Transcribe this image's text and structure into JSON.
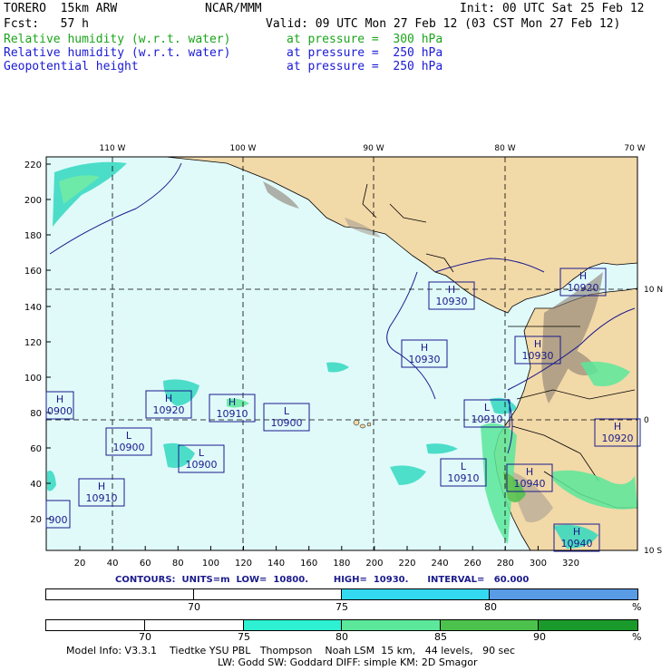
{
  "header": {
    "model": "TORERO  15km ARW",
    "center": "NCAR/MMM",
    "init": "Init: 00 UTC Sat 25 Feb 12",
    "fcst": "Fcst:   57 h",
    "valid": "Valid: 09 UTC Mon 27 Feb 12 (03 CST Mon 27 Feb 12)",
    "field1": "Relative humidity (w.r.t. water)",
    "field1_level": "at pressure =  300 hPa",
    "field2": "Relative humidity (w.r.t. water)",
    "field2_level": "at pressure =  250 hPa",
    "field3": "Geopotential height",
    "field3_level": "at pressure =  250 hPa"
  },
  "map": {
    "lon_labels": [
      "110 W",
      "100 W",
      "90 W",
      "80 W",
      "70 W"
    ],
    "lat_labels": [
      "10 N",
      "0",
      "10 S"
    ],
    "y_ticks": [
      "220",
      "200",
      "180",
      "160",
      "140",
      "120",
      "100",
      "80",
      "60",
      "40",
      "20"
    ],
    "x_ticks": [
      "20",
      "40",
      "60",
      "80",
      "100",
      "120",
      "140",
      "160",
      "180",
      "200",
      "220",
      "240",
      "260",
      "280",
      "300",
      "320"
    ],
    "pressure_systems": [
      {
        "type": "H",
        "value": "10930"
      },
      {
        "type": "H",
        "value": "10920"
      },
      {
        "type": "H",
        "value": "10930"
      },
      {
        "type": "H",
        "value": "10930"
      },
      {
        "type": "H",
        "value": "10920"
      },
      {
        "type": "H",
        "value": "10910"
      },
      {
        "type": "L",
        "value": "10900"
      },
      {
        "type": "L",
        "value": "10900"
      },
      {
        "type": "L",
        "value": "10900"
      },
      {
        "type": "L",
        "value": "10910"
      },
      {
        "type": "L",
        "value": "10910"
      },
      {
        "type": "H",
        "value": "10940"
      },
      {
        "type": "H",
        "value": "10920"
      },
      {
        "type": "H",
        "value": "10910"
      },
      {
        "type": "H",
        "value": "10940"
      },
      {
        "type": "H",
        "value": "0900"
      },
      {
        "type": "",
        "value": "900"
      }
    ]
  },
  "contours": {
    "text": "CONTOURS:  UNITS=m  LOW=  10800.        HIGH=  10930.      INTERVAL=   60.000"
  },
  "colorbar1": {
    "labels": [
      "70",
      "75",
      "80"
    ],
    "unit": "%",
    "colors": [
      "#ffffff",
      "#ffffff",
      "#33d9f0",
      "#5a9be6"
    ]
  },
  "colorbar2": {
    "labels": [
      "70",
      "75",
      "80",
      "85",
      "90"
    ],
    "unit": "%",
    "colors": [
      "#ffffff",
      "#ffffff",
      "#ffffff",
      "#2ef0d2",
      "#5be89a",
      "#4cc24c",
      "#1a9a2a"
    ]
  },
  "footer": {
    "line1": "Model Info: V3.3.1    Tiedtke YSU PBL   Thompson    Noah LSM  15 km,   44 levels,   90 sec",
    "line2": "LW: Godd SW: Goddard DIFF: simple KM: 2D Smagor"
  }
}
